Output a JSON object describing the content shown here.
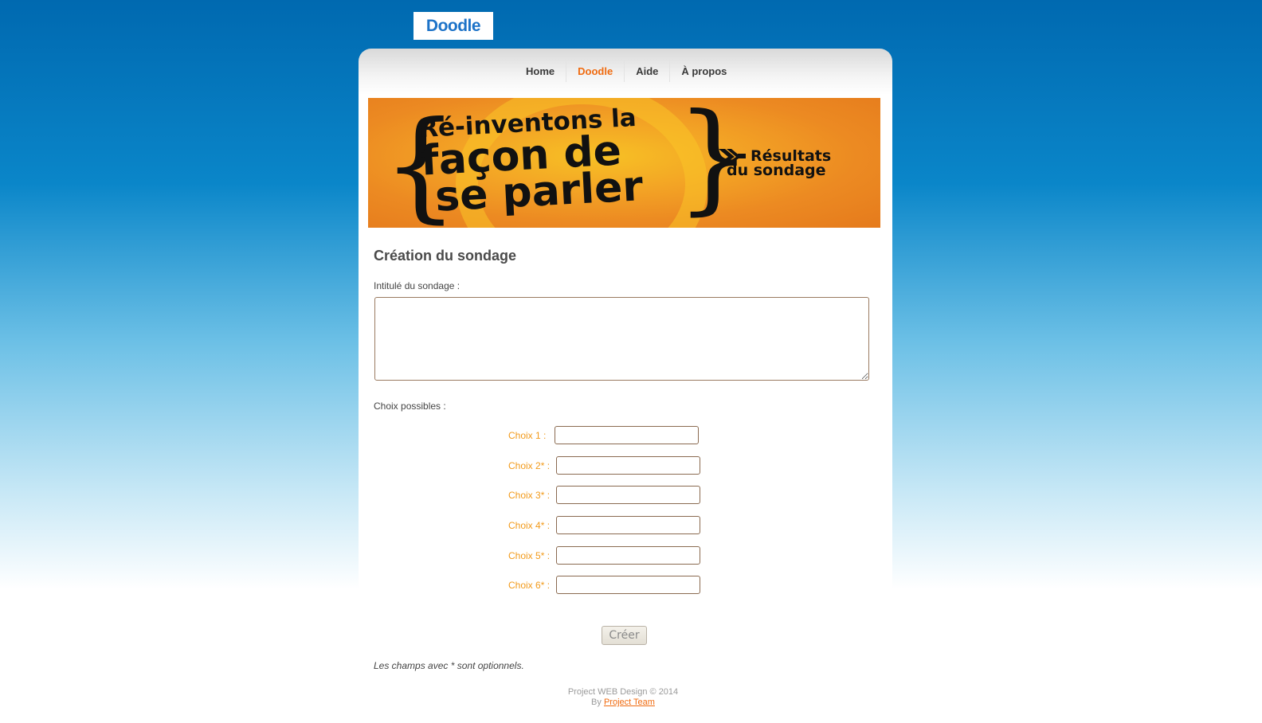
{
  "header": {
    "logo_text": "Doodle"
  },
  "nav": {
    "items": [
      {
        "label": "Home",
        "active": false
      },
      {
        "label": "Doodle",
        "active": true
      },
      {
        "label": "Aide",
        "active": false
      },
      {
        "label": "À propos",
        "active": false
      }
    ]
  },
  "banner": {
    "line1": "Ré-inventons la",
    "line2": "façon de",
    "line3": "se parler",
    "results_line1": "Résultats",
    "results_line2": "du sondage"
  },
  "form": {
    "title": "Création du sondage",
    "poll_label": "Intitulé du sondage :",
    "poll_value": "",
    "choices_label": "Choix possibles :",
    "choices": [
      {
        "label": "Choix 1  :",
        "value": ""
      },
      {
        "label": "Choix 2* :",
        "value": ""
      },
      {
        "label": "Choix 3* :",
        "value": ""
      },
      {
        "label": "Choix 4* :",
        "value": ""
      },
      {
        "label": "Choix 5* :",
        "value": ""
      },
      {
        "label": "Choix 6* :",
        "value": ""
      }
    ],
    "submit_label": "Créer",
    "note": "Les champs avec * sont optionnels."
  },
  "footer": {
    "copyright": "Project WEB Design © 2014",
    "by_prefix": "By",
    "by_link": "Project Team"
  },
  "colors": {
    "accent": "#f06b10",
    "choice_label": "#f29a1a",
    "logo_blue": "#1d73c8"
  }
}
